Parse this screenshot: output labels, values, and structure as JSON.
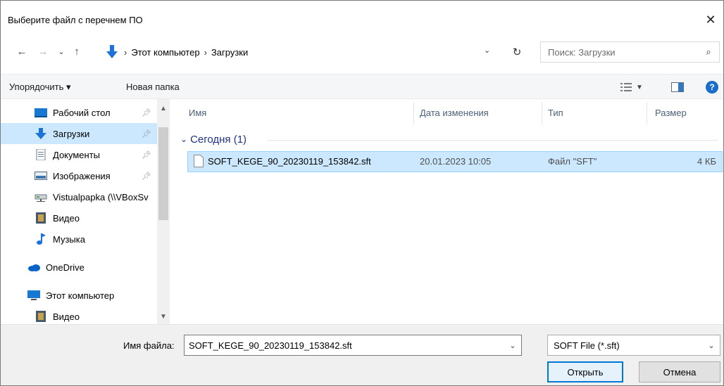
{
  "window": {
    "title": "Выберите файл с перечнем ПО",
    "close_glyph": "✕"
  },
  "navigation": {
    "back_glyph": "←",
    "forward_glyph": "→",
    "recent_glyph": "⌄",
    "up_glyph": "↑",
    "breadcrumbs": [
      "Этот компьютер",
      "Загрузки"
    ],
    "search_placeholder": "Поиск: Загрузки"
  },
  "toolbar": {
    "organize_label": "Упорядочить ▾",
    "new_folder_label": "Новая папка",
    "help_glyph": "?"
  },
  "sidebar": {
    "items": [
      {
        "label": "Рабочий стол",
        "icon": "desktop-icon",
        "pinned": true
      },
      {
        "label": "Загрузки",
        "icon": "downloads-icon",
        "pinned": true,
        "selected": true
      },
      {
        "label": "Документы",
        "icon": "documents-icon",
        "pinned": true
      },
      {
        "label": "Изображения",
        "icon": "pictures-icon",
        "pinned": true
      },
      {
        "label": "Vistualpapka (\\\\VBoxSv",
        "icon": "network-drive-icon",
        "pinned": false
      },
      {
        "label": "Видео",
        "icon": "video-icon",
        "pinned": false
      },
      {
        "label": "Музыка",
        "icon": "music-icon",
        "pinned": false
      },
      {
        "label": "OneDrive",
        "icon": "onedrive-icon",
        "pinned": false
      },
      {
        "label": "Этот компьютер",
        "icon": "this-pc-icon",
        "pinned": false
      },
      {
        "label": "Видео",
        "icon": "video-icon",
        "pinned": false
      }
    ]
  },
  "file_list": {
    "columns": [
      "Имя",
      "Дата изменения",
      "Тип",
      "Размер"
    ],
    "group_label": "Сегодня (1)",
    "rows": [
      {
        "name": "SOFT_KEGE_90_20230119_153842.sft",
        "modified": "20.01.2023 10:05",
        "type": "Файл \"SFT\"",
        "size": "4 КБ"
      }
    ]
  },
  "footer": {
    "filename_label": "Имя файла:",
    "filename_value": "SOFT_KEGE_90_20230119_153842.sft",
    "filter_value": "SOFT File (*.sft)",
    "open_label": "Открыть",
    "cancel_label": "Отмена"
  },
  "colors": {
    "selection": "#cce8ff",
    "accent": "#0078d7",
    "group_text": "#1e3287"
  }
}
